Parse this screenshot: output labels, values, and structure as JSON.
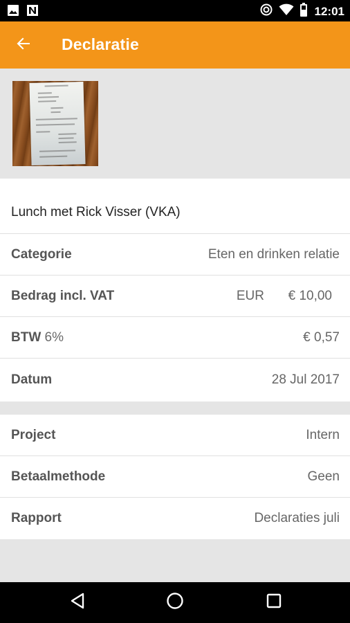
{
  "status_bar": {
    "time": "12:01",
    "left_icons": [
      "image-icon",
      "n-notification-icon"
    ],
    "right_icons": [
      "data-saver-icon",
      "wifi-icon",
      "battery-icon"
    ]
  },
  "app_bar": {
    "title": "Declaratie",
    "color": "#f39519",
    "back_icon": "arrow-back-icon"
  },
  "receipt_photo": {
    "icon": "receipt-thumbnail"
  },
  "declaration": {
    "description": "Lunch met Rick Visser (VKA)",
    "fields": [
      {
        "label": "Categorie",
        "value": "Eten en drinken relatie"
      },
      {
        "label": "Bedrag incl. VAT",
        "currency": "EUR",
        "amount": "€ 10,00"
      },
      {
        "label": "BTW",
        "label_sub": "6%",
        "value": "€ 0,57"
      },
      {
        "label": "Datum",
        "value": "28 Jul 2017"
      }
    ]
  },
  "extra": {
    "fields": [
      {
        "label": "Project",
        "value": "Intern"
      },
      {
        "label": "Betaalmethode",
        "value": "Geen"
      },
      {
        "label": "Rapport",
        "value": "Declaraties juli"
      }
    ]
  },
  "nav_bar": {
    "buttons": [
      "back-triangle-icon",
      "home-circle-icon",
      "recents-square-icon"
    ]
  }
}
